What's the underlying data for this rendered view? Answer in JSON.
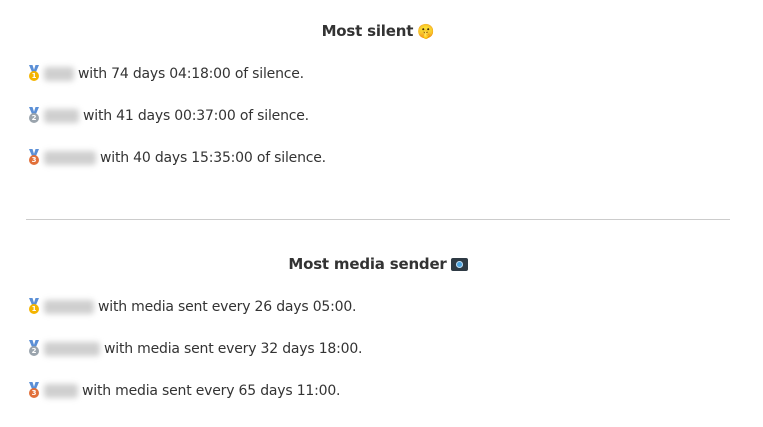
{
  "silent": {
    "title": "Most silent",
    "title_emoji": "🤫",
    "rows": [
      {
        "medal_color": "#f4b400",
        "medal_num": "1",
        "text": "with 74 days 04:18:00 of silence."
      },
      {
        "medal_color": "#9aa4ad",
        "medal_num": "2",
        "text": "with 41 days 00:37:00 of silence."
      },
      {
        "medal_color": "#e2703a",
        "medal_num": "3",
        "text": "with 40 days 15:35:00 of silence."
      }
    ]
  },
  "media": {
    "title": "Most media sender",
    "title_icon": "camera-icon",
    "rows": [
      {
        "medal_color": "#f4b400",
        "medal_num": "1",
        "text": "with media sent every 26 days 05:00."
      },
      {
        "medal_color": "#9aa4ad",
        "medal_num": "2",
        "text": "with media sent every 32 days 18:00."
      },
      {
        "medal_color": "#e2703a",
        "medal_num": "3",
        "text": "with media sent every 65 days 11:00."
      }
    ]
  }
}
